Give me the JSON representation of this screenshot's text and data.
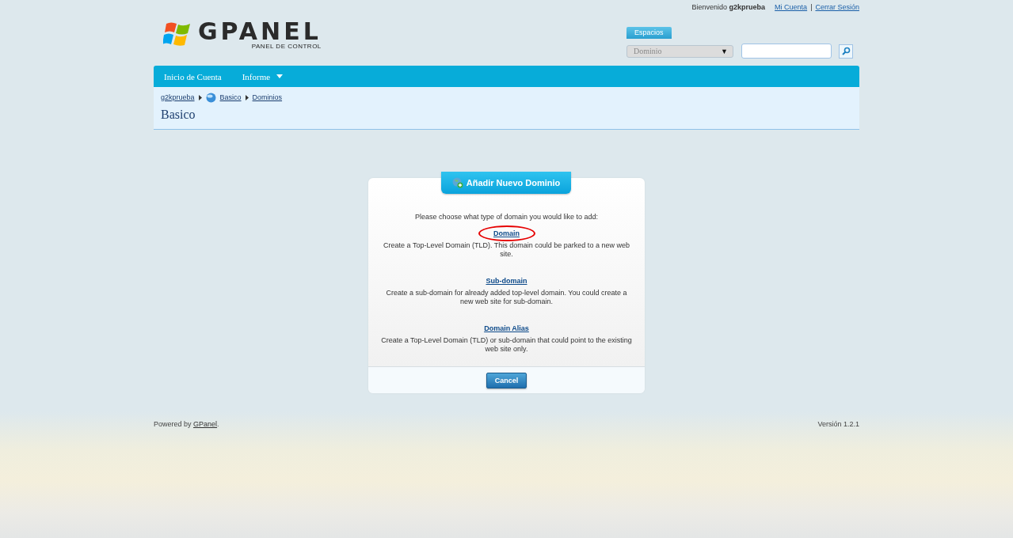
{
  "top_bar": {
    "greeting": "Bienvenido",
    "username": "g2kprueba",
    "links": [
      "Mi Cuenta",
      "Cerrar Sesión"
    ],
    "separator": "|"
  },
  "logo": {
    "wordmark": "GPANEL",
    "subtitle": "PANEL DE CONTROL"
  },
  "search": {
    "tab_label": "Espacios",
    "dropdown_value": "Dominio",
    "dropdown_arrow": "▼"
  },
  "nav": [
    {
      "label": "Inicio de Cuenta",
      "dropdown": false
    },
    {
      "label": "Informe",
      "dropdown": true
    }
  ],
  "breadcrumb": [
    "g2kprueba",
    "Basico",
    "Dominios"
  ],
  "page_title": "Basico",
  "dialog": {
    "title": "Añadir Nuevo Dominio",
    "intro": "Please choose what type of domain you would like to add:",
    "options": [
      {
        "link": "Domain",
        "description": "Create a Top-Level Domain (TLD). This domain could be parked to a new web site.",
        "circled": true
      },
      {
        "link": "Sub-domain",
        "description": "Create a sub-domain for already added top-level domain. You could create a new web site for sub-domain.",
        "circled": false
      },
      {
        "link": "Domain Alias",
        "description": "Create a Top-Level Domain (TLD) or sub-domain that could point to the existing web site only.",
        "circled": false
      }
    ],
    "cancel": "Cancel"
  },
  "footer": {
    "powered_prefix": "Powered by",
    "powered_link": "GPanel",
    "powered_suffix": ".",
    "version": "Versión 1.2.1"
  }
}
